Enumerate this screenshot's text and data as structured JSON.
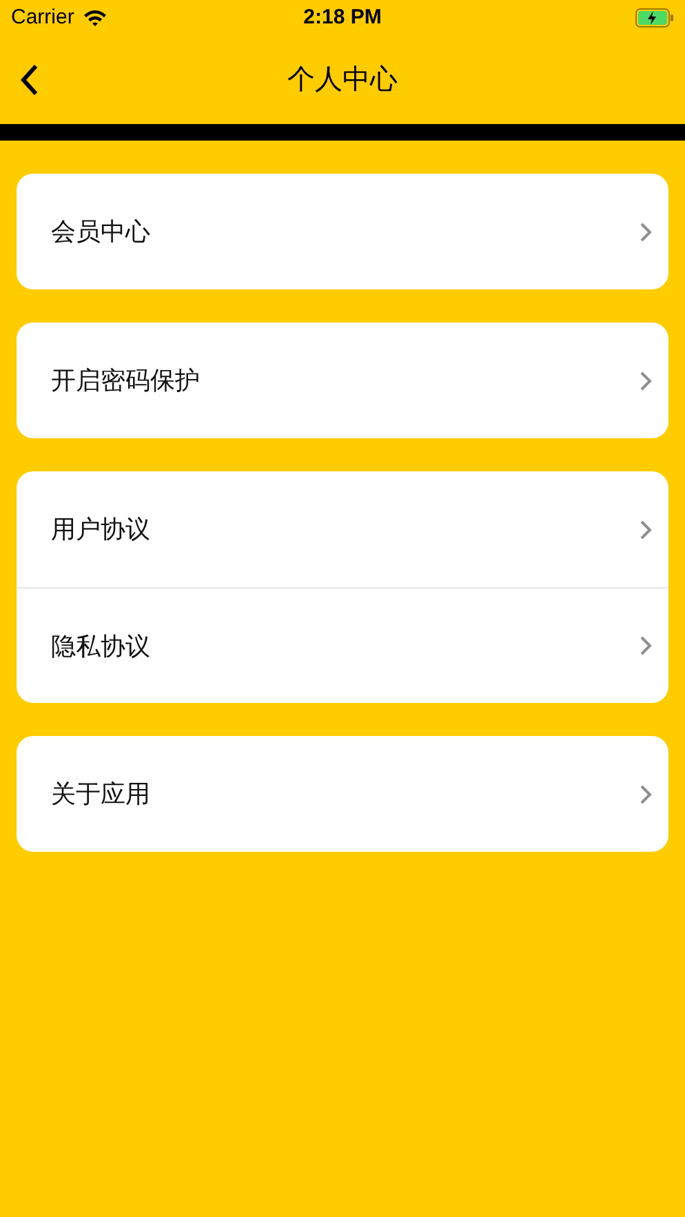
{
  "status_bar": {
    "carrier": "Carrier",
    "time": "2:18 PM"
  },
  "nav": {
    "title": "个人中心"
  },
  "groups": [
    {
      "items": [
        {
          "label": "会员中心"
        }
      ]
    },
    {
      "items": [
        {
          "label": "开启密码保护"
        }
      ]
    },
    {
      "items": [
        {
          "label": "用户协议"
        },
        {
          "label": "隐私协议"
        }
      ]
    },
    {
      "items": [
        {
          "label": "关于应用"
        }
      ]
    }
  ]
}
